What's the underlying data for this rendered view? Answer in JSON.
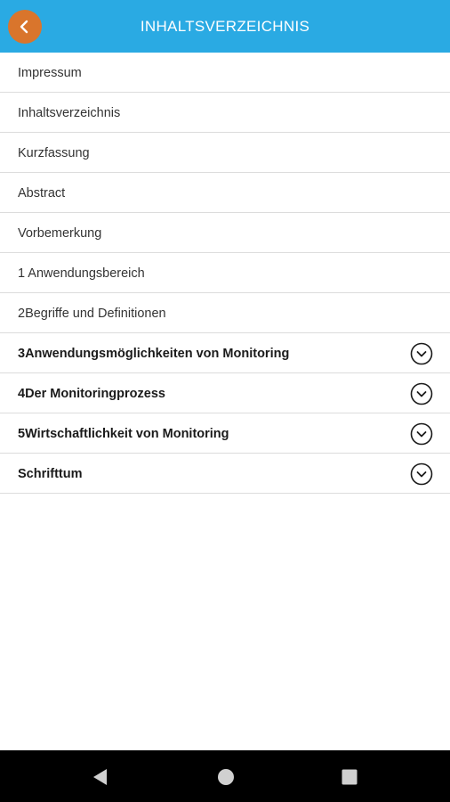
{
  "header": {
    "title": "INHALTSVERZEICHNIS",
    "back_icon": "chevron-left-icon",
    "colors": {
      "bar": "#2aaae3",
      "back_button": "#d9752c"
    }
  },
  "toc": {
    "items": [
      {
        "label": "Impressum",
        "expandable": false
      },
      {
        "label": "Inhaltsverzeichnis",
        "expandable": false
      },
      {
        "label": "Kurzfassung",
        "expandable": false
      },
      {
        "label": "Abstract",
        "expandable": false
      },
      {
        "label": "Vorbemerkung",
        "expandable": false
      },
      {
        "label": "1 Anwendungsbereich",
        "expandable": false
      },
      {
        "label": "2Begriffe und Definitionen",
        "expandable": false
      },
      {
        "label": "3Anwendungsmöglichkeiten von Monitoring",
        "expandable": true
      },
      {
        "label": "4Der Monitoringprozess",
        "expandable": true
      },
      {
        "label": "5Wirtschaftlichkeit von Monitoring",
        "expandable": true
      },
      {
        "label": "Schrifttum",
        "expandable": true
      }
    ],
    "expand_icon": "chevron-down-circle-icon"
  },
  "system_nav": {
    "back_icon": "triangle-back-icon",
    "home_icon": "circle-home-icon",
    "recent_icon": "square-recents-icon"
  }
}
